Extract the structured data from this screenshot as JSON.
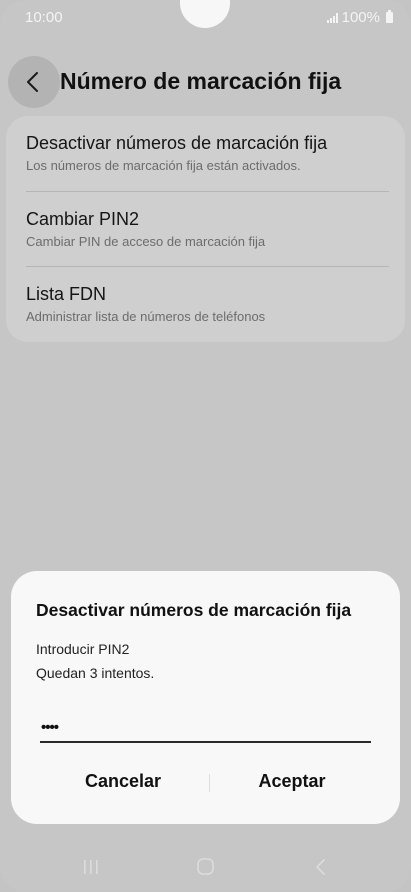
{
  "status": {
    "time": "10:00",
    "battery": "100%"
  },
  "header": {
    "title": "Número de marcación fija"
  },
  "items": [
    {
      "title": "Desactivar números de marcación fija",
      "subtitle": "Los números de marcación fija están activados."
    },
    {
      "title": "Cambiar PIN2",
      "subtitle": "Cambiar PIN de acceso de marcación fija"
    },
    {
      "title": "Lista FDN",
      "subtitle": "Administrar lista de números de teléfonos"
    }
  ],
  "dialog": {
    "title": "Desactivar números de marcación fija",
    "prompt": "Introducir PIN2",
    "attempts": "Quedan 3 intentos.",
    "pin_value": "••••",
    "cancel": "Cancelar",
    "accept": "Aceptar"
  }
}
